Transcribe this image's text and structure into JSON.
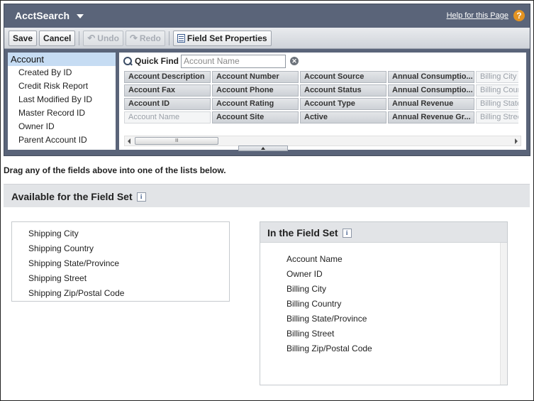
{
  "header": {
    "title": "AcctSearch",
    "help_link": "Help for this Page",
    "help_icon": "?"
  },
  "toolbar": {
    "save": "Save",
    "cancel": "Cancel",
    "undo": "Undo",
    "redo": "Redo",
    "field_set_properties": "Field Set Properties"
  },
  "object_list": [
    {
      "label": "Account",
      "selected": true
    },
    {
      "label": "Created By ID",
      "selected": false
    },
    {
      "label": "Credit Risk Report",
      "selected": false
    },
    {
      "label": "Last Modified By ID",
      "selected": false
    },
    {
      "label": "Master Record ID",
      "selected": false
    },
    {
      "label": "Owner ID",
      "selected": false
    },
    {
      "label": "Parent Account ID",
      "selected": false
    }
  ],
  "quick_find": {
    "label": "Quick Find",
    "placeholder": "Account Name",
    "value": ""
  },
  "field_grid": {
    "columns": [
      [
        {
          "label": "Account Description",
          "used": false
        },
        {
          "label": "Account Fax",
          "used": false
        },
        {
          "label": "Account ID",
          "used": false
        },
        {
          "label": "Account Name",
          "used": true
        }
      ],
      [
        {
          "label": "Account Number",
          "used": false
        },
        {
          "label": "Account Phone",
          "used": false
        },
        {
          "label": "Account Rating",
          "used": false
        },
        {
          "label": "Account Site",
          "used": false
        }
      ],
      [
        {
          "label": "Account Source",
          "used": false
        },
        {
          "label": "Account Status",
          "used": false
        },
        {
          "label": "Account Type",
          "used": false
        },
        {
          "label": "Active",
          "used": false
        }
      ],
      [
        {
          "label": "Annual Consumptio...",
          "used": false
        },
        {
          "label": "Annual Consumptio...",
          "used": false
        },
        {
          "label": "Annual Revenue",
          "used": false
        },
        {
          "label": "Annual Revenue Gr...",
          "used": false
        }
      ],
      [
        {
          "label": "Billing City",
          "used": true
        },
        {
          "label": "Billing Country",
          "used": true
        },
        {
          "label": "Billing State/Province",
          "used": true
        },
        {
          "label": "Billing Street",
          "used": true
        }
      ]
    ],
    "scroll_thumb_grip": "III"
  },
  "instructions": "Drag any of the fields above into one of the lists below.",
  "available": {
    "title": "Available for the Field Set",
    "info_icon": "i",
    "items": [
      "Shipping City",
      "Shipping Country",
      "Shipping State/Province",
      "Shipping Street",
      "Shipping Zip/Postal Code"
    ]
  },
  "in_field_set": {
    "title": "In the Field Set",
    "info_icon": "i",
    "items": [
      "Account Name",
      "Owner ID",
      "Billing City",
      "Billing Country",
      "Billing State/Province",
      "Billing Street",
      "Billing Zip/Postal Code"
    ]
  },
  "colors": {
    "header_bg": "#5a6479",
    "help_icon": "#e39321",
    "selected_object": "#c6dcf3",
    "section_header_bg": "#e2e4e7"
  }
}
